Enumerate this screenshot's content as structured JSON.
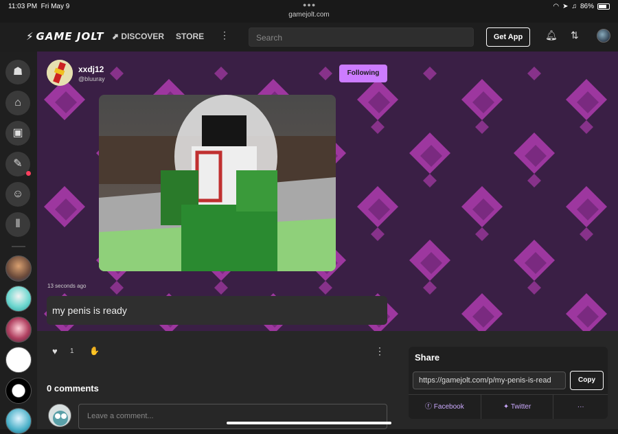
{
  "statusbar": {
    "time": "11:03 PM",
    "date": "Fri May 9",
    "url": "gamejolt.com",
    "battery": "86%"
  },
  "nav": {
    "logo": "GAME JOLT",
    "discover": "DISCOVER",
    "store": "STORE",
    "search_placeholder": "Search",
    "get_app": "Get App"
  },
  "sidebar": {
    "buttons": [
      "home-icon",
      "store-icon",
      "library-icon",
      "quests-icon",
      "chat-icon",
      "collections-icon"
    ],
    "has_notification_on": "quests-icon"
  },
  "post": {
    "author_name": "xxdj12",
    "author_handle": "@bluuray",
    "follow_label": "Following",
    "timestamp": "13 seconds ago",
    "text": "my penis is ready",
    "like_count": "1"
  },
  "comments": {
    "title": "0 comments",
    "placeholder": "Leave a comment..."
  },
  "share": {
    "title": "Share",
    "url": "https://gamejolt.com/p/my-penis-is-read",
    "copy_label": "Copy",
    "facebook": "Facebook",
    "twitter": "Twitter",
    "more": "···"
  },
  "colors": {
    "accent": "#cc7cff",
    "banner": "#3a1f45",
    "diamond": "#a83aa8"
  }
}
